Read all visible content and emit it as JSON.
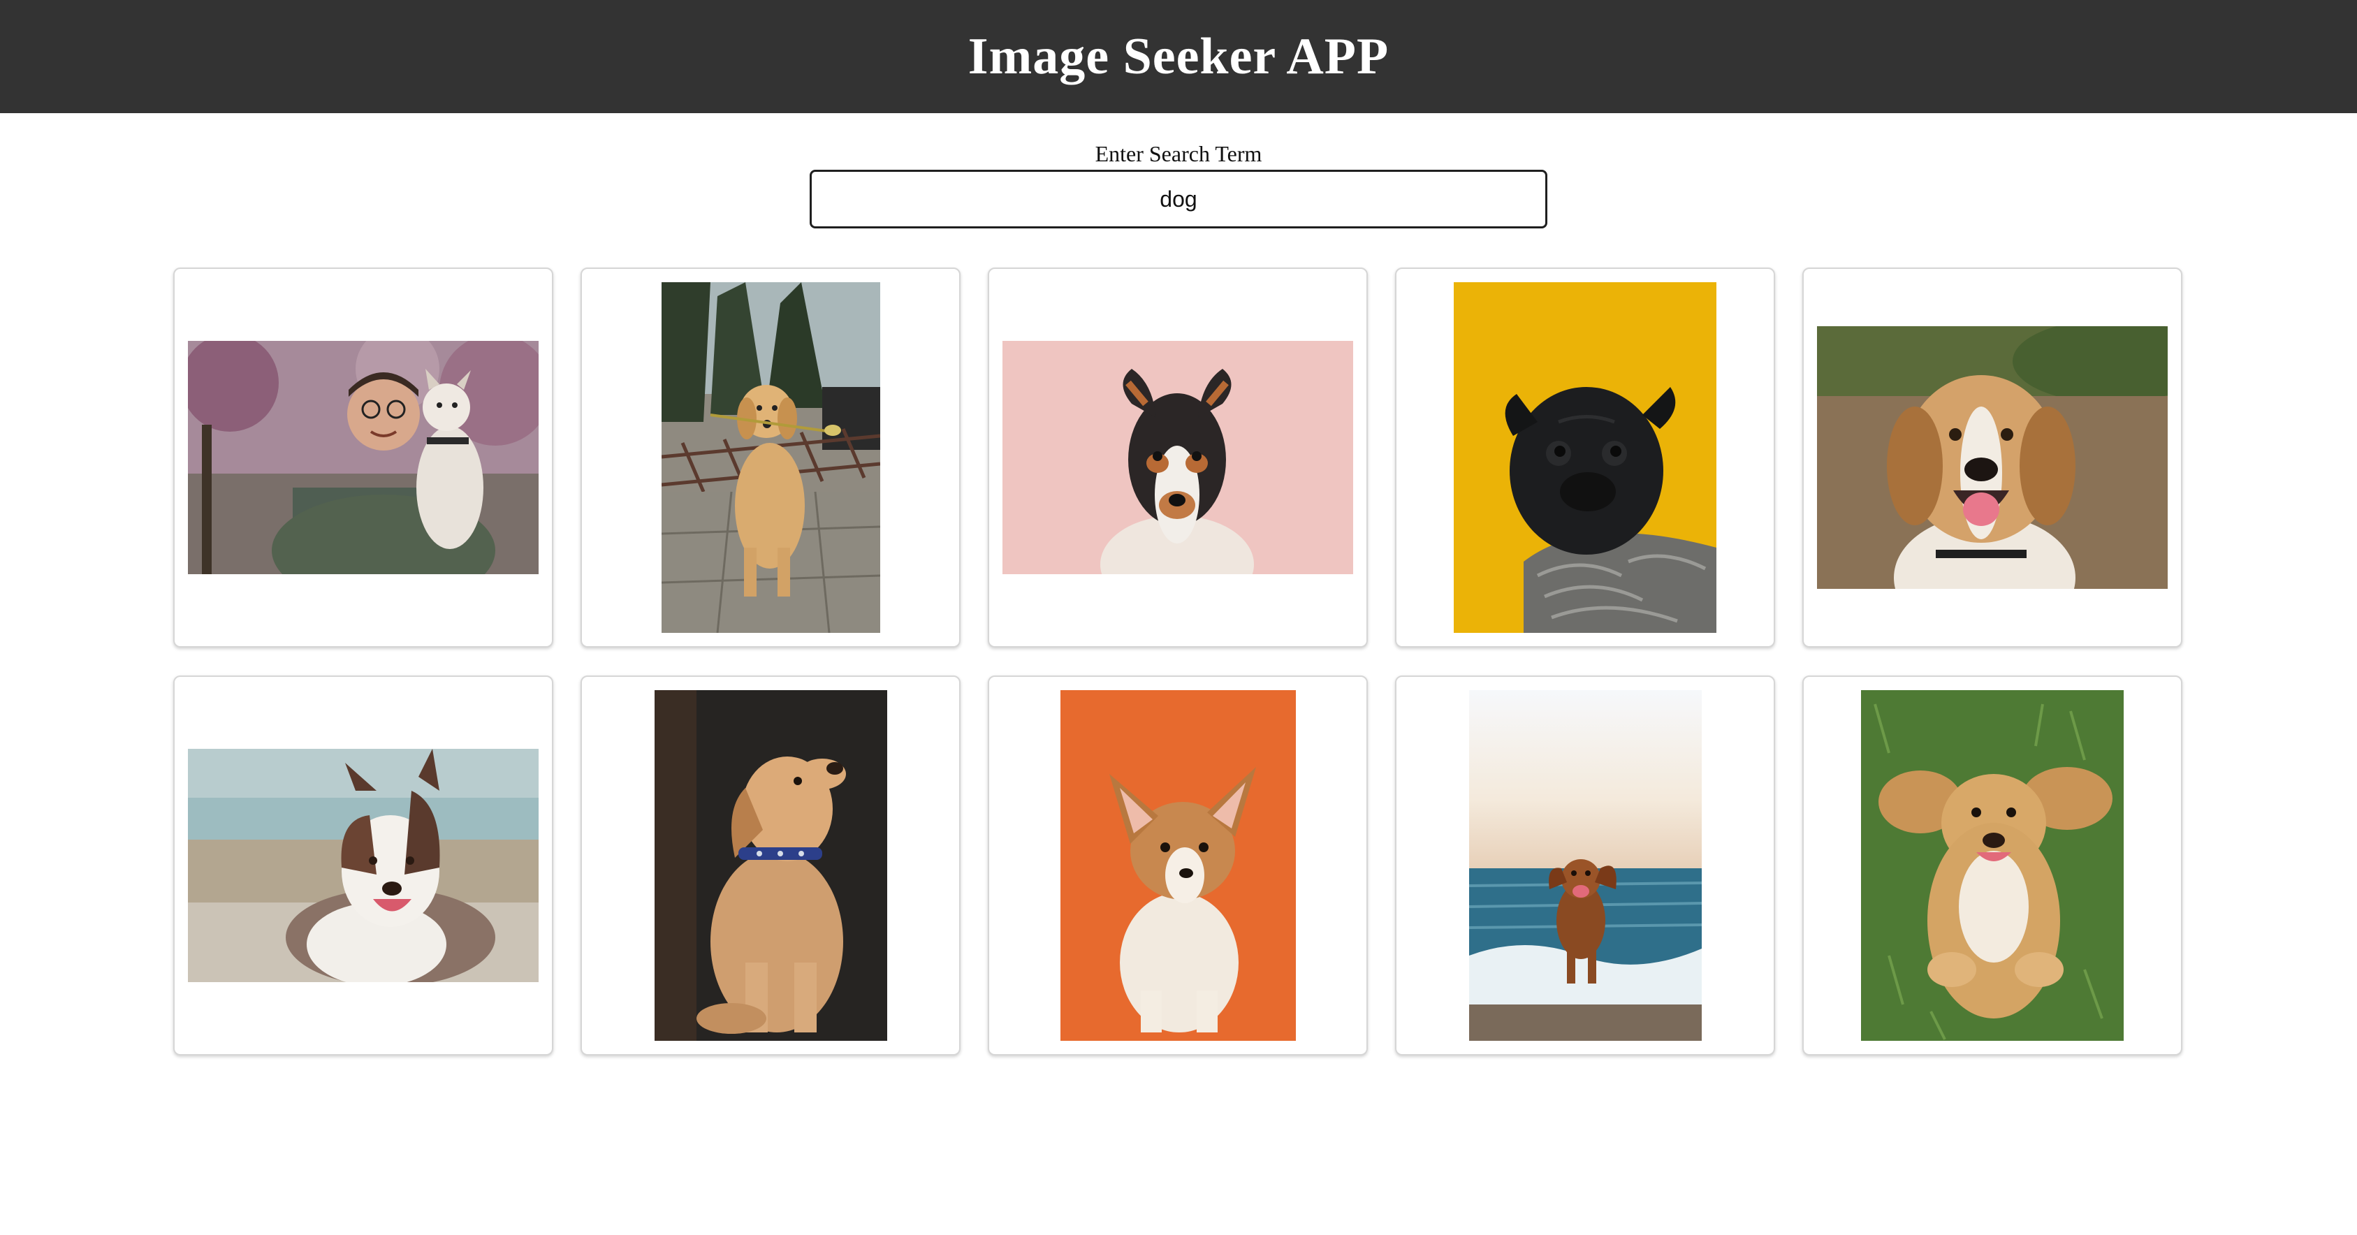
{
  "app": {
    "title": "Image Seeker APP"
  },
  "search": {
    "label": "Enter Search Term",
    "value": "dog"
  },
  "results": [
    {
      "icon": "photo-man-holding-dog"
    },
    {
      "icon": "photo-retriever-with-flower"
    },
    {
      "icon": "photo-terrier-pink-background"
    },
    {
      "icon": "photo-pug-yellow-background"
    },
    {
      "icon": "photo-beagle-smiling"
    },
    {
      "icon": "photo-australian-shepherd-beach"
    },
    {
      "icon": "photo-labrador-puppy-dark"
    },
    {
      "icon": "photo-corgi-orange-background"
    },
    {
      "icon": "photo-dog-running-ocean"
    },
    {
      "icon": "photo-spaniel-in-grass"
    }
  ],
  "colors": {
    "header_bg": "#333333",
    "header_text": "#ffffff",
    "card_border": "#d6d6d6"
  }
}
